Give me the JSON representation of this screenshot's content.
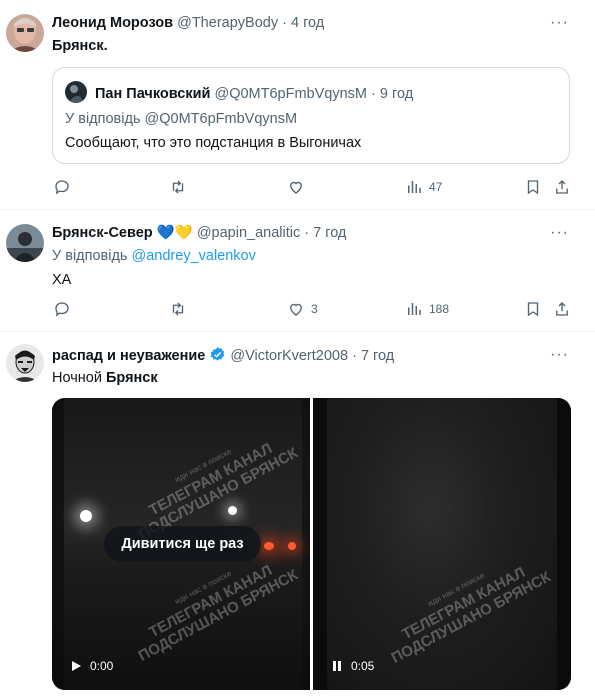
{
  "tweets": [
    {
      "name": "Леонид Морозов",
      "handle": "@TherapyBody",
      "dot": "·",
      "time": "4 год",
      "text": "Брянск.",
      "quote": {
        "name": "Пан Пачковский",
        "handle": "@Q0MT6pFmbVqynsM",
        "dot": "·",
        "time": "9 год",
        "reply_prefix": "У відповідь",
        "reply_to": "@Q0MT6pFmbVqynsM",
        "text": "Сообщают, что это подстанция в Выгоничах"
      },
      "stats": {
        "replies": "",
        "reposts": "",
        "likes": "",
        "views": "47"
      }
    },
    {
      "name": "Брянск-Север",
      "emoji": "💙💛",
      "handle": "@papin_analitic",
      "dot": "·",
      "time": "7 год",
      "reply_prefix": "У відповідь",
      "reply_to": "@andrey_valenkov",
      "text": "ХА",
      "stats": {
        "replies": "",
        "reposts": "",
        "likes": "3",
        "views": "188"
      }
    },
    {
      "name": "распад и неуважение",
      "verified": true,
      "handle": "@VictorKvert2008",
      "dot": "·",
      "time": "7 год",
      "text_prefix": "Ночной ",
      "text_bold": "Брянск",
      "videos": [
        {
          "watermark_small": "иди нас в поиске",
          "watermark_line1": "ТЕЛЕГРАМ КАНАЛ",
          "watermark_line2": "ПОДСЛУШАНО БРЯНСК",
          "replay_label": "Дивитися ще раз",
          "state": "play",
          "time": "0:00"
        },
        {
          "watermark_small": "иди нас в поиске",
          "watermark_line1": "ТЕЛЕГРАМ КАНАЛ",
          "watermark_line2": "ПОДСЛУШАНО БРЯНСК",
          "state": "pause",
          "time": "0:05"
        }
      ]
    }
  ],
  "more_label": "···",
  "colors": {
    "accent": "#1d9bf0",
    "text": "#0f1419",
    "muted": "#536471",
    "border": "#eff3f4"
  }
}
